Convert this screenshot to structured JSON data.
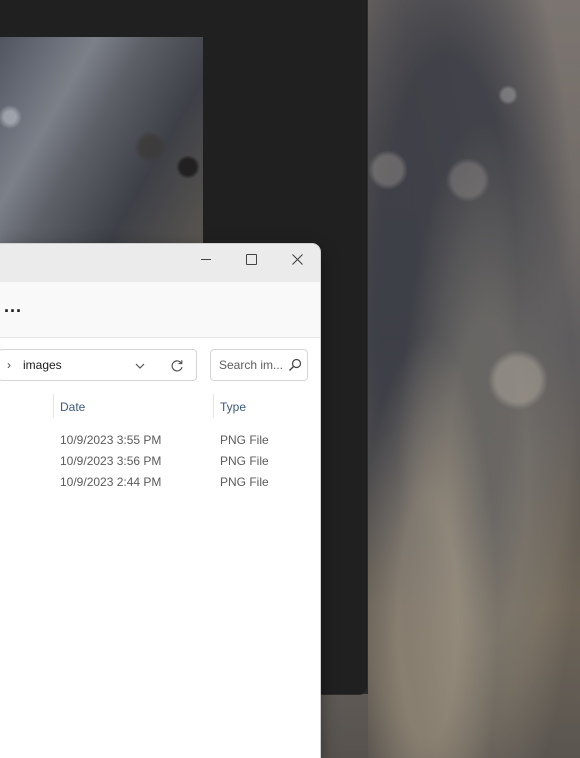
{
  "explorer": {
    "command_more": "...",
    "address": {
      "breadcrumb": "images",
      "chevron": "›"
    },
    "search": {
      "placeholder": "Search im..."
    },
    "columns": {
      "date": "Date",
      "type": "Type"
    },
    "files": [
      {
        "date": "10/9/2023 3:55 PM",
        "type": "PNG File"
      },
      {
        "date": "10/9/2023 3:56 PM",
        "type": "PNG File"
      },
      {
        "date": "10/9/2023 2:44 PM",
        "type": "PNG File"
      }
    ]
  },
  "icons": {
    "minimize": "minimize-icon",
    "maximize": "maximize-icon",
    "close": "close-icon",
    "dropdown": "chevron-down-icon",
    "refresh": "refresh-icon",
    "search": "search-icon"
  }
}
